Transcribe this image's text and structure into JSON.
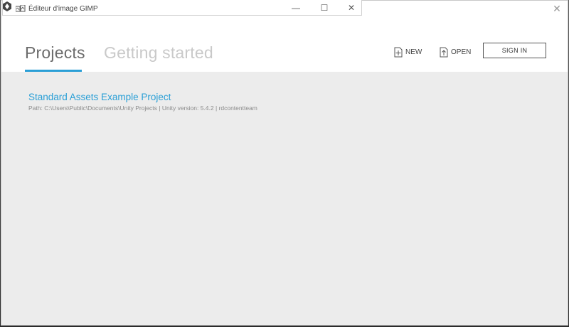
{
  "gimp_window": {
    "title": "Éditeur d'image GIMP",
    "controls": {
      "minimize": "—",
      "maximize": "☐",
      "close": "✕"
    }
  },
  "launcher": {
    "close_glyph": "✕",
    "tabs": [
      {
        "label": "Projects",
        "active": true
      },
      {
        "label": "Getting started",
        "active": false
      }
    ],
    "toolbar": {
      "new_label": "NEW",
      "open_label": "OPEN",
      "signin_label": "SIGN IN"
    },
    "projects": [
      {
        "title": "Standard Assets Example Project",
        "path": "Path: C:\\Users\\Public\\Documents\\Unity Projects | Unity version: 5.4.2 | rdcontentteam"
      }
    ]
  },
  "colors": {
    "accent": "#2a9fd6",
    "header_bg": "#ffffff",
    "body_bg": "#ececec"
  },
  "icons": [
    "unity-logo-icon",
    "gimp-icon",
    "new-project-icon",
    "open-project-icon",
    "close-icon"
  ]
}
